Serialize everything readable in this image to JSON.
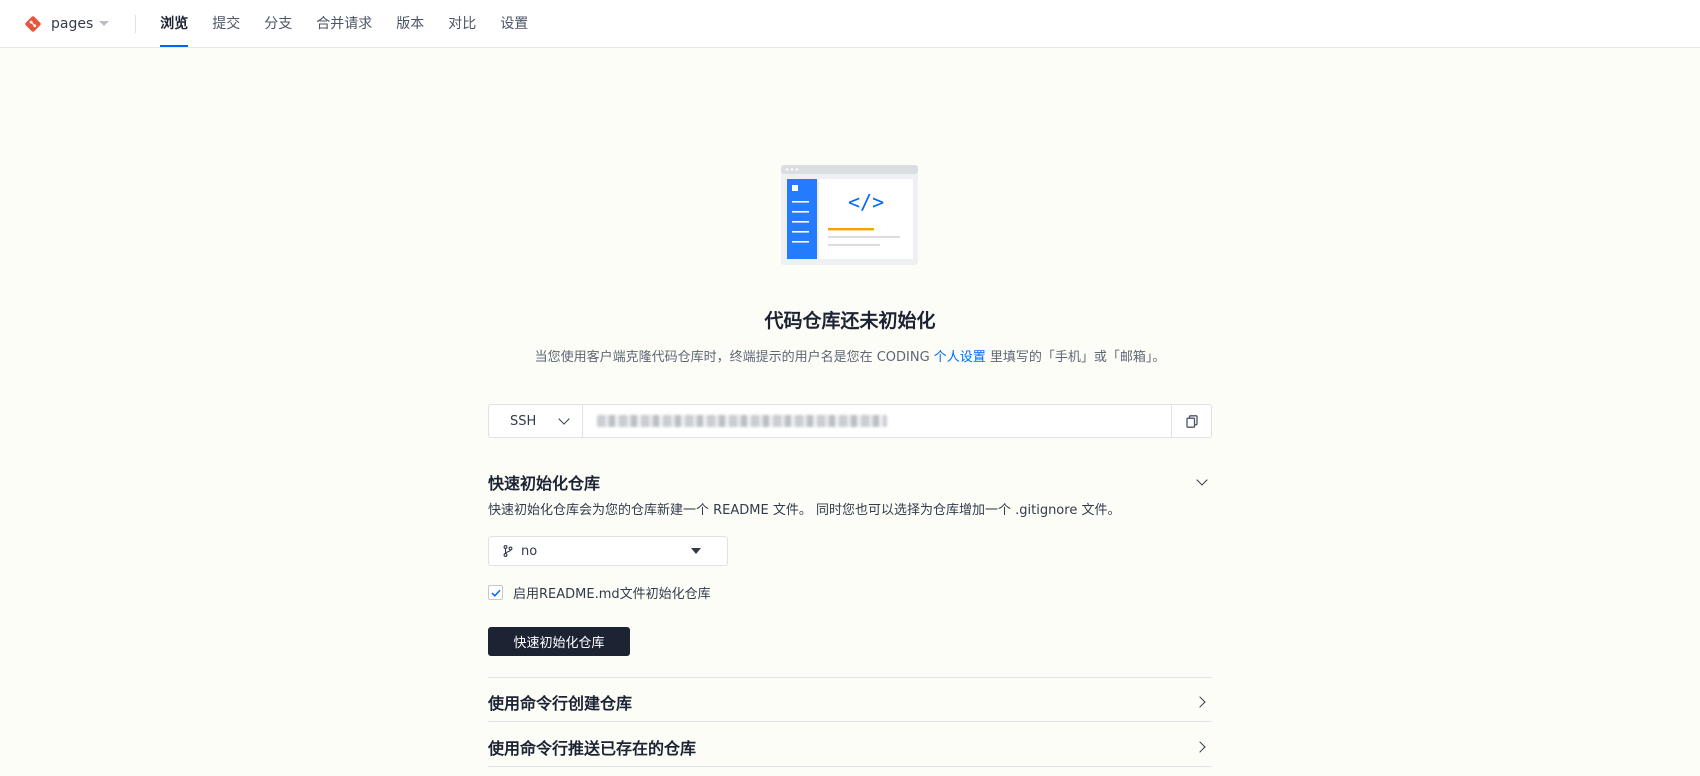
{
  "topbar": {
    "repo_name": "pages",
    "tabs": [
      {
        "label": "浏览",
        "active": true
      },
      {
        "label": "提交",
        "active": false
      },
      {
        "label": "分支",
        "active": false
      },
      {
        "label": "合并请求",
        "active": false
      },
      {
        "label": "版本",
        "active": false
      },
      {
        "label": "对比",
        "active": false
      },
      {
        "label": "设置",
        "active": false
      }
    ]
  },
  "empty": {
    "title": "代码仓库还未初始化",
    "desc_prefix": "当您使用客户端克隆代码仓库时，终端提示的用户名是您在 CODING ",
    "desc_link": "个人设置",
    "desc_suffix": " 里填写的「手机」或「邮箱」。"
  },
  "clone": {
    "protocol": "SSH"
  },
  "quick_init": {
    "title": "快速初始化仓库",
    "desc": "快速初始化仓库会为您的仓库新建一个 README 文件。 同时您也可以选择为仓库增加一个 .gitignore 文件。",
    "branch_value": "no",
    "checkbox_label": "启用README.md文件初始化仓库",
    "checkbox_checked": true,
    "button_label": "快速初始化仓库"
  },
  "sections": [
    {
      "title": "使用命令行创建仓库"
    },
    {
      "title": "使用命令行推送已存在的仓库"
    }
  ],
  "colors": {
    "accent": "#0066ff",
    "primary_button": "#1c2434",
    "logo": "#e8553d"
  }
}
